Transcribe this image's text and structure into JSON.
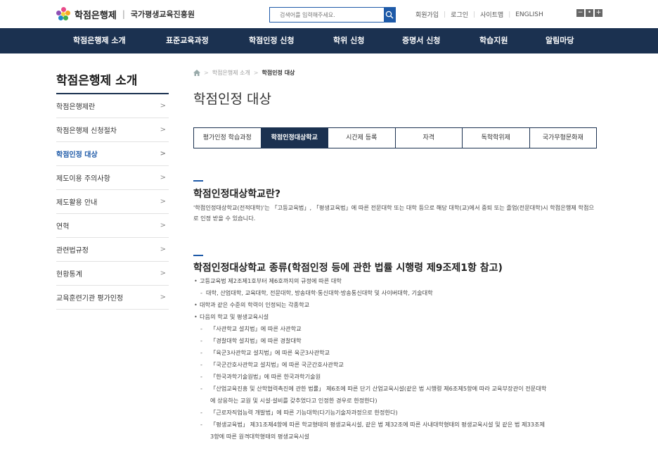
{
  "header": {
    "logo_title": "학점은행제",
    "logo_sep": "|",
    "logo_org": "국가평생교육진흥원",
    "search_placeholder": "검색어를 입력해주세요.",
    "util": [
      "회원가입",
      "로그인",
      "사이트맵",
      "ENGLISH"
    ],
    "zoom": [
      "−",
      "•",
      "+"
    ]
  },
  "gnb": [
    "학점은행제 소개",
    "표준교육과정",
    "학점인정 신청",
    "학위 신청",
    "증명서 신청",
    "학습지원",
    "알림마당"
  ],
  "sidebar": {
    "title": "학점은행제 소개",
    "items": [
      {
        "label": "학점은행제란"
      },
      {
        "label": "학점은행제 신청절차"
      },
      {
        "label": "학점인정 대상"
      },
      {
        "label": "제도이용 주의사항"
      },
      {
        "label": "제도활용 안내"
      },
      {
        "label": "연혁"
      },
      {
        "label": "관련법규정"
      },
      {
        "label": "현황통계"
      },
      {
        "label": "교육훈련기관 평가인정"
      }
    ],
    "active_index": 2,
    "arrow": ">"
  },
  "breadcrumb": [
    "학점은행제 소개",
    "학점인정 대상"
  ],
  "page_title": "학점인정 대상",
  "tabs": [
    "평가인정 학습과정",
    "학점인정대상학교",
    "시간제 등록",
    "자격",
    "독학학위제",
    "국가무형문화재"
  ],
  "active_tab": 1,
  "section1": {
    "heading": "학점인정대상학교란?",
    "body": "'학점인정대상학교(전적대학)'는 「고등교육법」, 「평생교육법」에 따른 전문대학 또는 대학 등으로 해당 대학(교)에서 중퇴 또는 졸업(전문대학)시 학점은행제 학점으로 인정 받을 수 있습니다."
  },
  "section2": {
    "heading": "학점인정대상학교 종류(학점인정 등에 관한 법률 시행령 제9조제1항 참고)",
    "items": [
      {
        "level": "b1",
        "text": "고등교육법 제2조제1호부터 제6호까지의 규정에 따른 대학"
      },
      {
        "level": "b2",
        "text": "대학, 산업대학, 교육대학, 전문대학, 방송대학·통신대학·방송통신대학 및 사이버대학, 기술대학"
      },
      {
        "level": "b1",
        "text": "대학과 같은 수준의 학력이 인정되는 각종학교"
      },
      {
        "level": "b1",
        "text": "다음의 학교 및 평생교육시설"
      },
      {
        "level": "b2s",
        "text": "「사관학교 설치법」에 따른 사관학교"
      },
      {
        "level": "b2s",
        "text": "「경찰대학 설치법」에 따른 경찰대학"
      },
      {
        "level": "b2s",
        "text": "「육군3사관학교 설치법」에 따른 육군3사관학교"
      },
      {
        "level": "b2s",
        "text": "「국군간호사관학교 설치법」에 따른 국군간호사관학교"
      },
      {
        "level": "b2s",
        "text": "「한국과학기술원법」에 따른 한국과학기술원"
      },
      {
        "level": "b2s",
        "text": "「산업교육진흥 및 산학협력촉진에 관한 법률」 제6조에 따른 단기 산업교육시설(같은 법 시행령 제6조제5항에 따라 교육부장관이 전문대학"
      },
      {
        "level": "cont",
        "text": "에 상응하는 교원 및 시설·설비를 갖추었다고 인정한 경우로 한정한다)"
      },
      {
        "level": "b2s",
        "text": "「근로자직업능력 개발법」에 따른 기능대학(다기능기술자과정으로 한정한다)"
      },
      {
        "level": "b2s",
        "text": "「평생교육법」 제31조제4항에 따른 학교형태의 평생교육시설, 같은 법 제32조에 따른 사내대학형태의 평생교육시설 및 같은 법 제33조제"
      },
      {
        "level": "cont",
        "text": "3항에 따른 원격대학형태의 평생교육시설"
      }
    ]
  }
}
